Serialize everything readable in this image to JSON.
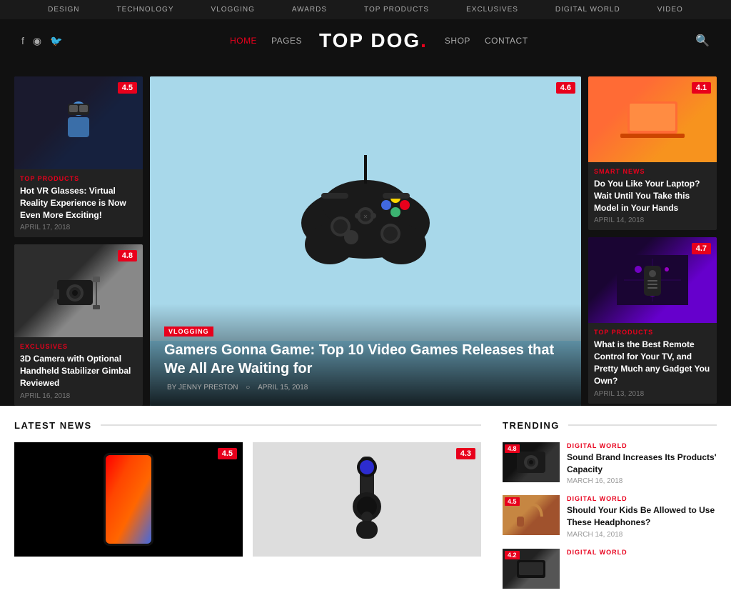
{
  "topbar": {
    "items": [
      "Design",
      "Technology",
      "Vlogging",
      "Awards",
      "Top Products",
      "Exclusives",
      "Digital World",
      "Video"
    ]
  },
  "header": {
    "social": [
      {
        "name": "facebook",
        "icon": "f"
      },
      {
        "name": "instagram",
        "icon": "◉"
      },
      {
        "name": "twitter",
        "icon": "🐦"
      }
    ],
    "nav": [
      {
        "label": "HOME",
        "active": true
      },
      {
        "label": "PAGES",
        "active": false
      }
    ],
    "title": "TOP DOG",
    "title_dot": ".",
    "right_nav": [
      {
        "label": "SHOP"
      },
      {
        "label": "CONTACT"
      }
    ]
  },
  "hero": {
    "center": {
      "badge": "4.6",
      "category": "VLOGGING",
      "title": "Gamers Gonna Game: Top 10 Video Games Releases that We All Are Waiting for",
      "author": "BY JENNY PRESTON",
      "date": "APRIL 15, 2018"
    },
    "left_cards": [
      {
        "badge": "4.5",
        "category": "TOP PRODUCTS",
        "title": "Hot VR Glasses: Virtual Reality Experience is Now Even More Exciting!",
        "date": "APRIL 17, 2018"
      },
      {
        "badge": "4.8",
        "category": "EXCLUSIVES",
        "title": "3D Camera with Optional Handheld Stabilizer Gimbal Reviewed",
        "date": "APRIL 16, 2018"
      }
    ],
    "right_cards": [
      {
        "badge": "4.1",
        "category": "SMART NEWS",
        "title": "Do You Like Your Laptop? Wait Until You Take this Model in Your Hands",
        "date": "APRIL 14, 2018"
      },
      {
        "badge": "4.7",
        "category": "TOP PRODUCTS",
        "title": "What is the Best Remote Control for Your TV, and Pretty Much any Gadget You Own?",
        "date": "APRIL 13, 2018"
      }
    ]
  },
  "latest_news": {
    "section_title": "LATEST NEWS",
    "cards": [
      {
        "badge": "4.5"
      },
      {
        "badge": "4.3"
      }
    ]
  },
  "trending": {
    "section_title": "TRENDING",
    "items": [
      {
        "badge": "4.8",
        "category": "DIGITAL WORLD",
        "title": "Sound Brand Increases Its Products' Capacity",
        "date": "MARCH 16, 2018"
      },
      {
        "badge": "4.5",
        "category": "DIGITAL WORLD",
        "title": "Should Your Kids Be Allowed to Use These Headphones?",
        "date": "MARCH 14, 2018"
      },
      {
        "badge": "4.2",
        "category": "DIGITAL WORLD",
        "title": "",
        "date": ""
      }
    ]
  }
}
